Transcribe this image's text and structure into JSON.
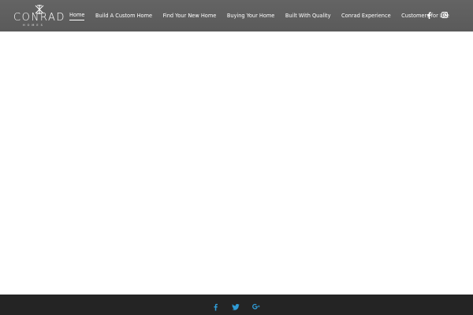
{
  "header": {
    "logo": {
      "word": "CONRAD",
      "sub": "HOMES"
    },
    "nav": [
      {
        "label": "Home",
        "active": true
      },
      {
        "label": "Build A Custom Home"
      },
      {
        "label": "Find Your New Home"
      },
      {
        "label": "Buying Your Home"
      },
      {
        "label": "Built With Quality"
      },
      {
        "label": "Conrad Experience"
      },
      {
        "label": "Customers for Life"
      }
    ],
    "social": [
      "facebook-icon",
      "instagram-icon"
    ]
  },
  "footer": {
    "social": [
      "facebook-icon",
      "twitter-icon",
      "google-plus-icon"
    ]
  },
  "colors": {
    "header_bg": "#5f5f5f",
    "footer_bg": "#242424",
    "footer_icon": "#2f9bd6",
    "nav_text": "#ffffff"
  }
}
